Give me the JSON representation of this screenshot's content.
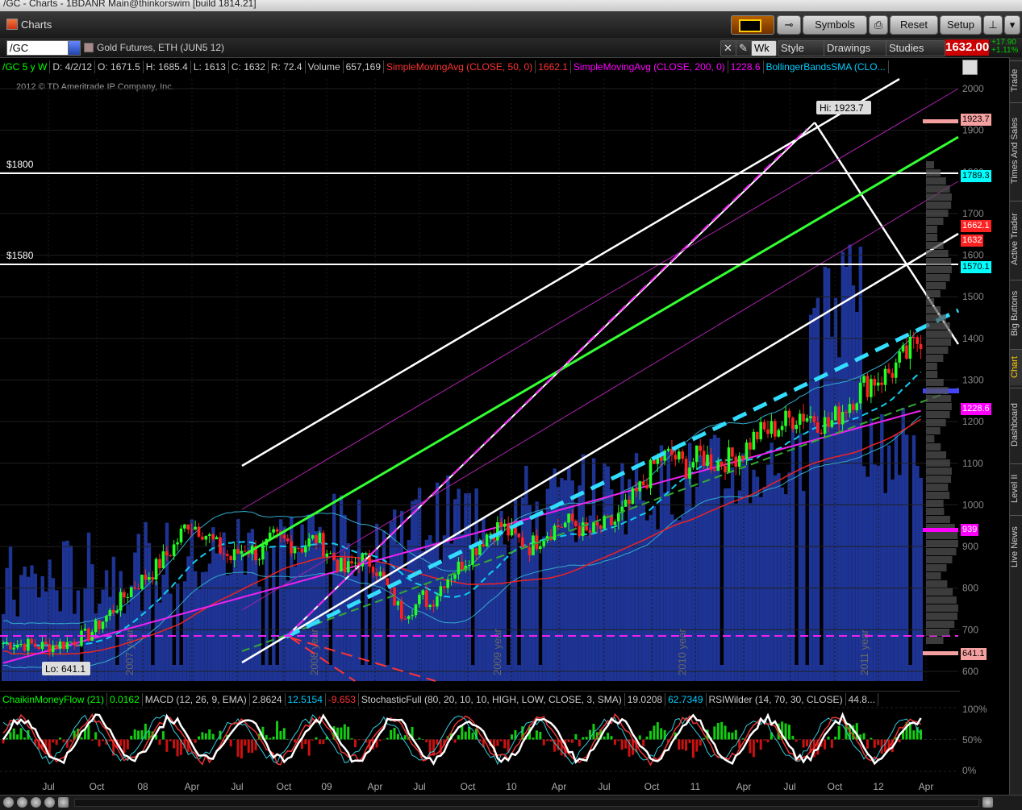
{
  "window_title": "/GC - Charts - 1BDANR Main@thinkorswim [build 1814.21]",
  "tab": {
    "label": "Charts"
  },
  "toolbar": {
    "symbols_label": "Symbols",
    "reset_label": "Reset",
    "setup_label": "Setup"
  },
  "symbol": {
    "value": "/GC",
    "description": "Gold Futures, ETH (JUN5 12)",
    "last_price": "1632.00",
    "change_abs": "+17.90",
    "change_pct": "+1.11%"
  },
  "chart_tools": {
    "period_label": "Wk",
    "style_label": "Style",
    "drawings_label": "Drawings",
    "studies_label": "Studies"
  },
  "info": {
    "symbol_period": "/GC 5 y W",
    "date": "D: 4/2/12",
    "open": "O: 1671.5",
    "high": "H: 1685.4",
    "low": "L: 1613",
    "close": "C: 1632",
    "range": "R: 72.4",
    "volume_label": "Volume",
    "volume_value": "657,169",
    "sma50_label": "SimpleMovingAvg (CLOSE, 50, 0)",
    "sma50_value": "1662.1",
    "sma200_label": "SimpleMovingAvg (CLOSE, 200, 0)",
    "sma200_value": "1228.6",
    "bb_label": "BollingerBandsSMA (CLO..."
  },
  "copyright": "2012 © TD Ameritrade IP Company, Inc.",
  "annotations": {
    "hi_label": "Hi: 1923.7",
    "lo_label": "Lo: 641.1",
    "line_1800": "$1800",
    "line_1580": "$1580",
    "year_labels": [
      "2007 year",
      "2008 year",
      "2009 year",
      "2010 year",
      "2011 year"
    ]
  },
  "price_tags": [
    {
      "label": "1923.7",
      "price": 1923.7,
      "bg": "#f4a0a0"
    },
    {
      "label": "1789.3",
      "price": 1789.3,
      "bg": "#00ffff"
    },
    {
      "label": "1662.1",
      "price": 1668,
      "bg": "#ff2222"
    },
    {
      "label": "1632",
      "price": 1634,
      "bg": "#ff2222"
    },
    {
      "label": "1570.1",
      "price": 1570.1,
      "bg": "#00ffff"
    },
    {
      "label": "1228.6",
      "price": 1228.6,
      "bg": "#ff00ff"
    },
    {
      "label": "939",
      "price": 939,
      "bg": "#ff00ff"
    },
    {
      "label": "641.1",
      "price": 641.1,
      "bg": "#f4a0a0"
    }
  ],
  "lower": {
    "cmf_label": "ChaikinMoneyFlow (21)",
    "cmf_value": "0.0162",
    "macd_label": "MACD (12, 26, 9, EMA)",
    "macd_value": "2.8624",
    "macd_avg": "12.5154",
    "macd_diff": "-9.653",
    "stoch_label": "StochasticFull (80, 20, 10, 10, HIGH, LOW, CLOSE, 3, SMA)",
    "stoch_k": "19.0208",
    "stoch_d": "62.7349",
    "rsi_label": "RSIWilder (14, 70, 30, CLOSE)",
    "rsi_value": "44.8...",
    "axis": [
      "100%",
      "50%",
      "0%"
    ]
  },
  "sidebar_tabs": [
    "Trade",
    "Times And Sales",
    "Active Trader",
    "Big Buttons",
    "Chart",
    "Dashboard",
    "Level II",
    "Live News"
  ],
  "chart_data": {
    "type": "candlestick",
    "title": "/GC 5 y W",
    "y_ticks": [
      2000,
      1900,
      1800,
      1700,
      1600,
      1500,
      1400,
      1300,
      1200,
      1100,
      1000,
      900,
      800,
      700,
      600
    ],
    "ylim": [
      580,
      2040
    ],
    "x_ticks": [
      "Jul",
      "Oct",
      "08",
      "Apr",
      "Jul",
      "Oct",
      "09",
      "Apr",
      "Jul",
      "Oct",
      "10",
      "Apr",
      "Jul",
      "Oct",
      "11",
      "Apr",
      "Jul",
      "Oct",
      "12",
      "Apr"
    ],
    "xlim": [
      0,
      259
    ],
    "close_path": [
      [
        0,
        668
      ],
      [
        6,
        665
      ],
      [
        12,
        660
      ],
      [
        18,
        668
      ],
      [
        24,
        688
      ],
      [
        30,
        740
      ],
      [
        36,
        800
      ],
      [
        42,
        840
      ],
      [
        48,
        900
      ],
      [
        52,
        960
      ],
      [
        56,
        940
      ],
      [
        60,
        900
      ],
      [
        64,
        870
      ],
      [
        68,
        900
      ],
      [
        72,
        880
      ],
      [
        76,
        920
      ],
      [
        80,
        910
      ],
      [
        84,
        900
      ],
      [
        88,
        920
      ],
      [
        92,
        880
      ],
      [
        96,
        840
      ],
      [
        100,
        870
      ],
      [
        104,
        860
      ],
      [
        108,
        800
      ],
      [
        112,
        740
      ],
      [
        116,
        760
      ],
      [
        118,
        780
      ],
      [
        120,
        760
      ],
      [
        124,
        820
      ],
      [
        128,
        850
      ],
      [
        132,
        890
      ],
      [
        136,
        930
      ],
      [
        140,
        950
      ],
      [
        144,
        920
      ],
      [
        148,
        900
      ],
      [
        152,
        930
      ],
      [
        156,
        950
      ],
      [
        160,
        960
      ],
      [
        164,
        930
      ],
      [
        168,
        945
      ],
      [
        172,
        960
      ],
      [
        176,
        1000
      ],
      [
        180,
        1050
      ],
      [
        184,
        1110
      ],
      [
        188,
        1120
      ],
      [
        192,
        1090
      ],
      [
        196,
        1120
      ],
      [
        200,
        1100
      ],
      [
        204,
        1110
      ],
      [
        208,
        1130
      ],
      [
        212,
        1170
      ],
      [
        216,
        1180
      ],
      [
        220,
        1200
      ],
      [
        224,
        1220
      ],
      [
        228,
        1210
      ],
      [
        232,
        1190
      ],
      [
        236,
        1230
      ],
      [
        240,
        1270
      ],
      [
        244,
        1300
      ],
      [
        248,
        1310
      ],
      [
        252,
        1340
      ],
      [
        256,
        1380
      ],
      [
        259,
        1420
      ]
    ],
    "volume_label": "Volume",
    "notes": "weekly gold futures price, ~5 years, with volume, SMA(50), SMA(200) and Bollinger bands"
  }
}
